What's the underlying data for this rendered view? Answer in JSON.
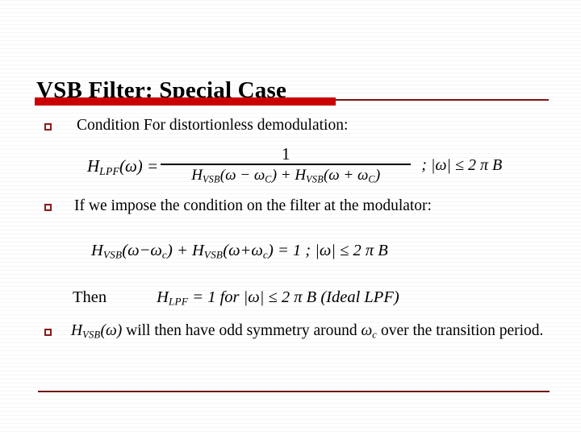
{
  "slide": {
    "title": "VSB Filter: Special Case",
    "accent_color": "#cc0000",
    "accent_dark_color": "#8c1b1b",
    "background_color": "#ffffff",
    "text_color": "#000000"
  },
  "bullets": [
    {
      "marker": "hollow-square",
      "text": "Condition For distortionless demodulation:"
    },
    {
      "marker": "hollow-square",
      "text": "If we impose the condition on the filter at the modulator:"
    },
    {
      "marker": "hollow-square",
      "text": "HVSB(ω) will then have odd symmetry around ωc over the transition period."
    }
  ],
  "equation_1": {
    "lhs_H": "H",
    "lhs_sub": "LPF",
    "lhs_arg": "(ω) =",
    "numerator": "1",
    "denominator_H1": "H",
    "denominator_sub1": "VSB",
    "denominator_arg1": "(ω − ω",
    "denominator_arg1_sub": "C",
    "denominator_mid": ") + ",
    "denominator_H2": "H",
    "denominator_sub2": "VSB",
    "denominator_arg2": "(ω + ω",
    "denominator_arg2_sub": "C",
    "denominator_close": ")",
    "condition": "; |ω| ≤ 2 π B",
    "plain": "H_LPF(ω) = 1 / ( H_VSB(ω−ω_C) + H_VSB(ω+ω_C) ) ; |ω| ≤ 2 π B"
  },
  "equation_2": {
    "H1": "H",
    "sub1": "VSB",
    "arg1_open": "(ω−ω",
    "arg1_sub": "c",
    "arg1_close": ")",
    "plus": " + ",
    "H2": "H",
    "sub2": "VSB",
    "arg2_open": "(ω+ω",
    "arg2_sub": "c",
    "arg2_close": ")",
    "rhs": " = 1 ; |ω| ≤ 2 π B",
    "plain": "H_VSB(ω−ω_c) + H_VSB(ω+ω_c) = 1 ; |ω| ≤ 2 π B"
  },
  "then_line": {
    "label": "Then",
    "H": "H",
    "sub": "LPF",
    "rest": " = 1 for |ω| ≤ 2 π B (Ideal LPF)",
    "plain": "Then   H_LPF = 1 for |ω| ≤ 2 π B (Ideal LPF)"
  },
  "bullet_3_parts": {
    "H": "H",
    "sub": "VSB",
    "arg": "(ω)",
    "line1_rest": " will then have odd symmetry around ",
    "omega": "ω",
    "omega_sub": "c",
    "line1_tail": " over the",
    "line2": "transition period."
  }
}
